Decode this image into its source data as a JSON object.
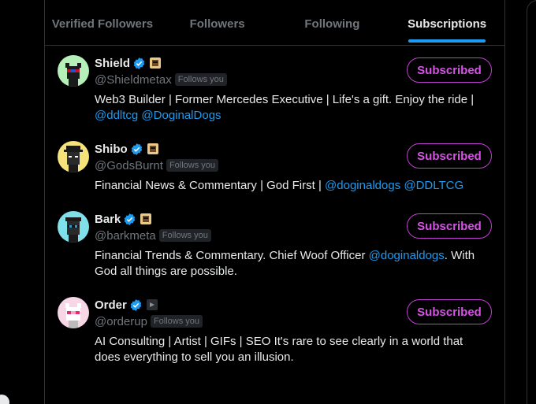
{
  "tabs": [
    {
      "label": "Verified Followers",
      "active": false
    },
    {
      "label": "Followers",
      "active": false
    },
    {
      "label": "Following",
      "active": false
    },
    {
      "label": "Subscriptions",
      "active": true
    }
  ],
  "users": [
    {
      "name": "Shield",
      "handle": "@Shieldmetax",
      "follows_badge": "Follows you",
      "button_label": "Subscribed",
      "bio_text": "Web3 Builder | Former Mercedes Executive | Life's a gift. Enjoy the ride |",
      "bio_mentions": "@ddltcg @DoginalDogs",
      "icons": [
        "avatar-dog-shield",
        "verified-badge-icon",
        "affiliate-dog-icon"
      ]
    },
    {
      "name": "Shibo",
      "handle": "@GodsBurnt",
      "follows_badge": "Follows you",
      "button_label": "Subscribed",
      "bio_text": "Financial News & Commentary | God First |",
      "bio_mentions": "@doginaldogs @DDLTCG",
      "icons": [
        "avatar-dog-shibo",
        "verified-badge-icon",
        "affiliate-dog-icon"
      ]
    },
    {
      "name": "Bark",
      "handle": "@barkmeta",
      "follows_badge": "Follows you",
      "button_label": "Subscribed",
      "bio_text": "Financial Trends & Commentary. Chief Woof Officer",
      "bio_mention_inline": "@doginaldogs",
      "bio_text_after": ". With God all things are possible.",
      "icons": [
        "avatar-dog-bark",
        "verified-badge-icon",
        "affiliate-dog-icon"
      ]
    },
    {
      "name": "Order",
      "handle": "@orderup",
      "follows_badge": "Follows you",
      "button_label": "Subscribed",
      "bio_text": "AI Consulting | Artist | GIFs | SEO It's rare to see clearly in a world that does everything to sell you an illusion.",
      "icons": [
        "avatar-cat-order",
        "verified-badge-icon",
        "affiliate-arrow-icon"
      ]
    }
  ],
  "colors": {
    "accent_blue": "#1d9bf0",
    "subscribed_purple": "#d653e6",
    "muted_text": "#71767b",
    "background": "#000000"
  }
}
